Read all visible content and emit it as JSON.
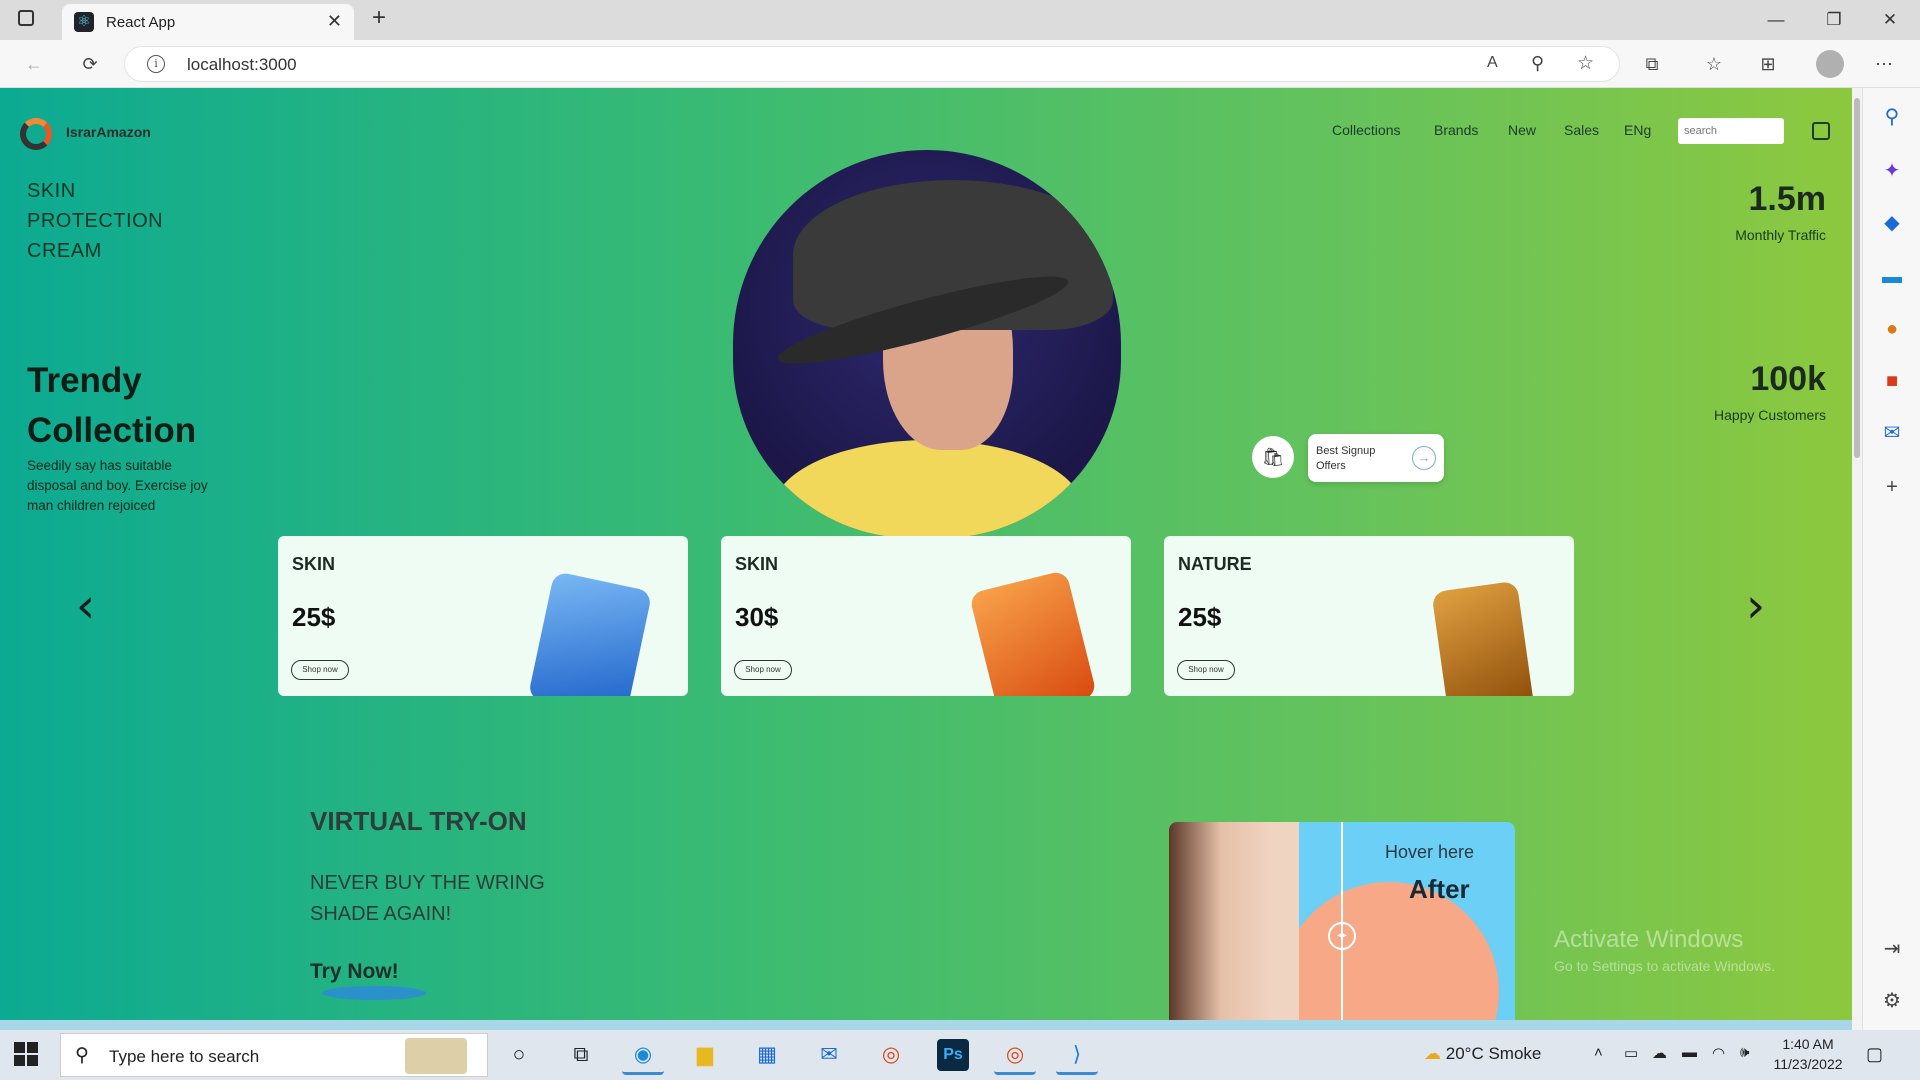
{
  "browser": {
    "tab_title": "React App",
    "url": "localhost:3000",
    "new_tab": "+",
    "close_tab": "✕"
  },
  "nav": {
    "brand": "IsrarAmazon",
    "links": [
      "Collections",
      "Brands",
      "New",
      "Sales",
      "ENg"
    ],
    "search_placeholder": "search"
  },
  "hero": {
    "headline_lines": [
      "SKIN",
      "PROTECTION",
      "CREAM"
    ],
    "trendy_title_1": "Trendy",
    "trendy_title_2": "Collection",
    "trendy_desc": "Seedily say has suitable disposal and boy. Exercise joy man children rejoiced",
    "stats": [
      {
        "value": "1.5m",
        "label": "Monthly Traffic"
      },
      {
        "value": "100k",
        "label": "Happy Customers"
      }
    ],
    "offer_text": "Best Signup Offers"
  },
  "cards": [
    {
      "category": "SKIN",
      "price": "25$",
      "button": "Shop now",
      "product_color": "#2a76d8"
    },
    {
      "category": "SKIN",
      "price": "30$",
      "button": "Shop now",
      "product_color": "#e8621c"
    },
    {
      "category": "NATURE",
      "price": "25$",
      "button": "Shop now",
      "product_color": "#b86a12"
    }
  ],
  "virtual": {
    "title": "VIRTUAL TRY-ON",
    "subtitle": "NEVER BUY THE WRING SHADE AGAIN!",
    "cta": "Try Now!",
    "hover_text": "Hover here",
    "after_text": "After"
  },
  "watermark": {
    "line1": "Activate Windows",
    "line2": "Go to Settings to activate Windows."
  },
  "taskbar": {
    "search_placeholder": "Type here to search",
    "weather": "20°C  Smoke",
    "time": "1:40 AM",
    "date": "11/23/2022"
  },
  "colors": {
    "gradient_start": "#0caa92",
    "gradient_end": "#8dc83e",
    "card_bg": "#eefcf4",
    "ba_blue": "#6ccff6",
    "ba_peach": "#f6a887"
  }
}
